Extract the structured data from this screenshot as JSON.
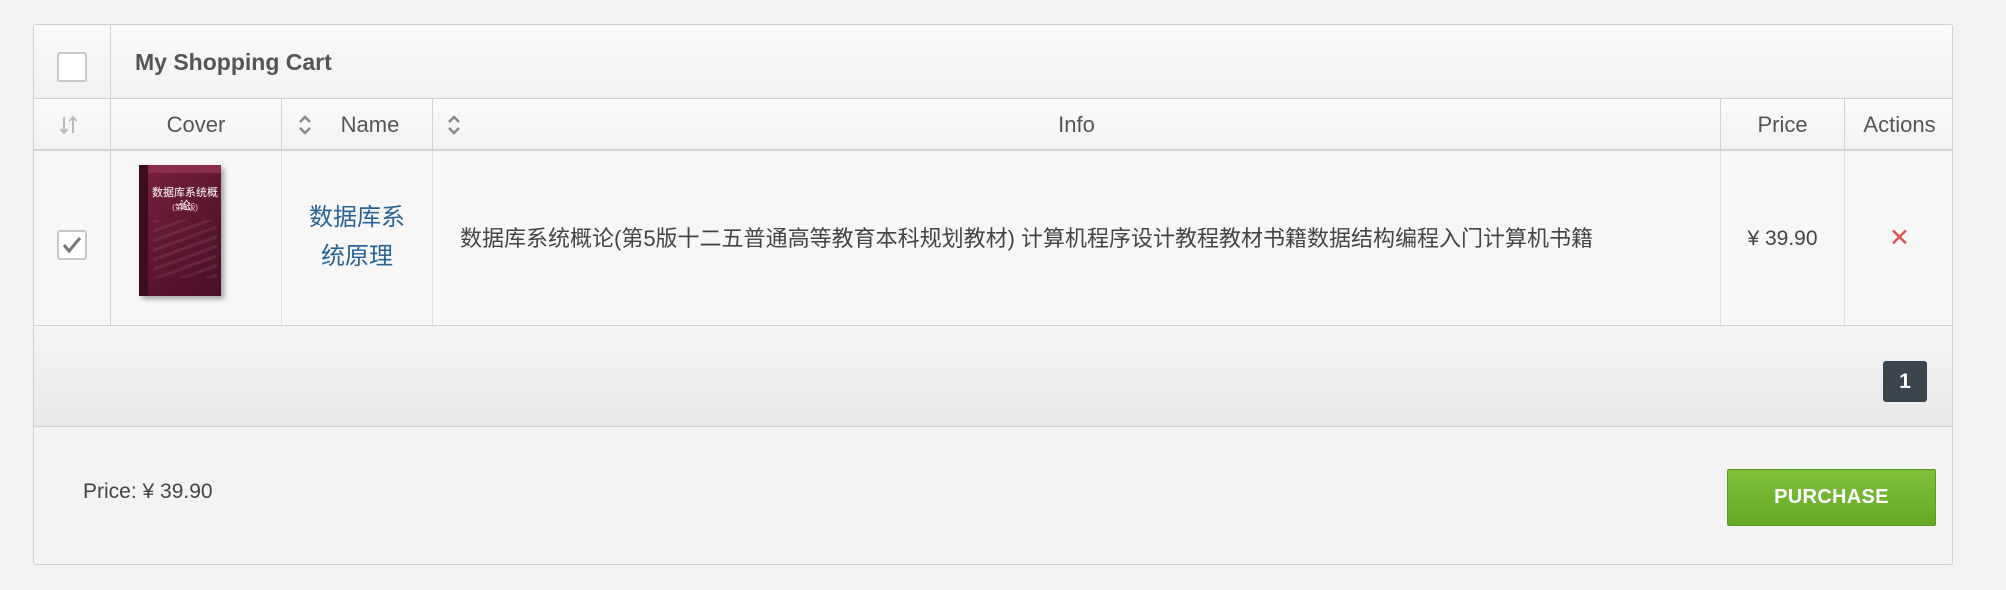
{
  "cart": {
    "title": "My Shopping Cart",
    "select_all_checked": false
  },
  "columns": {
    "cover": "Cover",
    "name": "Name",
    "info": "Info",
    "price": "Price",
    "actions": "Actions"
  },
  "rows": [
    {
      "checked": true,
      "cover_title": "数据库系统概论",
      "cover_edition": "(第5版)",
      "name": "数据库系统原理",
      "info": "数据库系统概论(第5版十二五普通高等教育本科规划教材) 计算机程序设计教程教材书籍数据结构编程入门计算机书籍",
      "price": "¥ 39.90",
      "delete_glyph": "✕"
    }
  ],
  "pagination": {
    "current_page": "1"
  },
  "footer": {
    "total": "Price: ¥ 39.90",
    "purchase_label": "PURCHASE"
  },
  "colors": {
    "link": "#2a6496",
    "delete": "#d9534f",
    "purchase": "#6cb22d",
    "page_button": "#3a4550"
  }
}
